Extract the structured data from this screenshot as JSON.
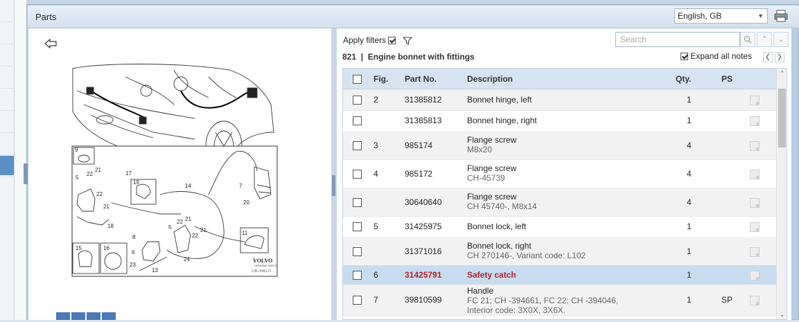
{
  "window": {
    "title": "Parts"
  },
  "language": {
    "selected": "English, GB"
  },
  "filters": {
    "label": "Apply filters",
    "checked": true
  },
  "search": {
    "placeholder": "Search"
  },
  "section": {
    "number": "821",
    "separator": "|",
    "name": "Engine bonnet with fittings"
  },
  "expand_notes": {
    "label": "Expand all notes",
    "checked": true
  },
  "table": {
    "columns": [
      "Fig.",
      "Part No.",
      "Description",
      "Qty.",
      "PS"
    ],
    "rows": [
      {
        "fig": "2",
        "part": "31385812",
        "desc": "Bonnet hinge, left",
        "sub": "",
        "qty": "1",
        "ps": ""
      },
      {
        "fig": "",
        "part": "31385813",
        "desc": "Bonnet hinge, right",
        "sub": "",
        "qty": "1",
        "ps": ""
      },
      {
        "fig": "3",
        "part": "985174",
        "desc": "Flange screw",
        "sub": "M8x20",
        "qty": "4",
        "ps": ""
      },
      {
        "fig": "4",
        "part": "985172",
        "desc": "Flange screw",
        "sub": "CH-45739",
        "qty": "4",
        "ps": ""
      },
      {
        "fig": "",
        "part": "30640640",
        "desc": "Flange screw",
        "sub": "CH 45740-, M8x14",
        "qty": "4",
        "ps": ""
      },
      {
        "fig": "5",
        "part": "31425975",
        "desc": "Bonnet lock, left",
        "sub": "",
        "qty": "1",
        "ps": ""
      },
      {
        "fig": "",
        "part": "31371016",
        "desc": "Bonnet lock, right",
        "sub": "CH 270146-, Variant code: L102",
        "qty": "1",
        "ps": ""
      },
      {
        "fig": "6",
        "part": "31425791",
        "desc": "Safety catch",
        "sub": "",
        "qty": "1",
        "ps": "",
        "selected": true
      },
      {
        "fig": "7",
        "part": "39810599",
        "desc": "Handle",
        "sub": "FC 21; CH -394661, FC 22; CH -394046,",
        "sub2": "Interior code: 3X0X, 3X6X.",
        "qty": "1",
        "ps": "SP"
      }
    ]
  },
  "diagram": {
    "brand": "VOLVO",
    "brand_sub": "GENUINE PARTS",
    "ref": "GR-398233",
    "callouts": [
      "9",
      "21",
      "22",
      "5",
      "17",
      "22",
      "21",
      "19",
      "14",
      "7",
      "20",
      "18",
      "8",
      "5",
      "22",
      "21",
      "21",
      "22",
      "11",
      "15",
      "16",
      "6",
      "24",
      "23",
      "13"
    ]
  },
  "colors": {
    "selected_row": "#c8dcf0",
    "selected_text": "#b2232b",
    "header_bg": "#d6e3f0"
  }
}
